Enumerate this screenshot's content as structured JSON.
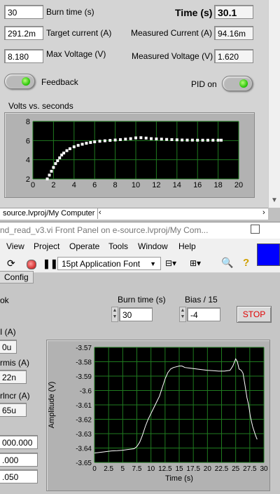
{
  "front_panel_top": {
    "burn_time": {
      "label": "Burn time (s)",
      "value": "30"
    },
    "target_current": {
      "label": "Target current (A)",
      "value": "291.2m"
    },
    "max_voltage": {
      "label": "Max Voltage (V)",
      "value": "8.180"
    },
    "time": {
      "label": "Time (s)",
      "value": "30.1"
    },
    "measured_current": {
      "label": "Measured Current (A)",
      "value": "94.16m"
    },
    "measured_voltage": {
      "label": "Measured Voltage (V)",
      "value": "1.620"
    },
    "feedback": {
      "label": "Feedback",
      "state": "on"
    },
    "pid": {
      "label": "PID on",
      "state": "on"
    },
    "graph_title": "Volts vs. seconds",
    "led_color": "#1fbf00"
  },
  "project_tab": {
    "label": "source.lvproj/My Computer"
  },
  "window2": {
    "title": "nd_read_v3.vi Front Panel on e-source.lvproj/My Com...",
    "menus": [
      "View",
      "Project",
      "Operate",
      "Tools",
      "Window",
      "Help"
    ],
    "font_select": "15pt Application Font",
    "config_tab": "Config",
    "burn_time": {
      "label": "Burn time (s)",
      "value": "30"
    },
    "bias": {
      "label": "Bias / 15",
      "value": "-4"
    },
    "stop_label": "STOP",
    "left_labels": {
      "ok": "ok",
      "current": "I (A)",
      "current_value": "0u",
      "rms": "rmis (A)",
      "rms_value": "22n",
      "incr": "rlncr (A)",
      "incr_value": "65u"
    },
    "left_values": [
      "000.000",
      ".000",
      ".050"
    ],
    "indicator_color": "#0000ff"
  },
  "chart_data": [
    {
      "type": "scatter",
      "title": "Volts vs. seconds",
      "xlabel": "",
      "ylabel": "",
      "xlim": [
        0,
        20
      ],
      "ylim": [
        2,
        8
      ],
      "xticks": [
        "0",
        "2",
        "4",
        "6",
        "8",
        "10",
        "12",
        "14",
        "16",
        "18",
        "20"
      ],
      "yticks": [
        "2",
        "4",
        "6",
        "8"
      ],
      "grid": true,
      "series": [
        {
          "x": [
            1.4,
            1.6,
            1.8,
            2.0,
            2.2,
            2.4,
            2.6,
            2.8,
            3.0,
            3.3,
            3.6,
            4.0,
            4.4,
            4.8,
            5.2,
            5.6,
            6.0,
            6.5,
            7.0,
            7.5,
            8.0,
            8.5,
            9.0,
            9.5,
            10.0,
            10.5,
            11.0,
            11.5,
            12.0,
            12.5,
            13.0,
            13.5,
            14.0,
            14.5,
            15.0,
            15.5,
            16.0,
            16.5,
            17.0,
            17.5,
            18.0,
            18.3
          ],
          "y": [
            2.0,
            2.4,
            2.8,
            3.2,
            3.6,
            3.9,
            4.2,
            4.5,
            4.7,
            4.95,
            5.15,
            5.35,
            5.5,
            5.62,
            5.72,
            5.8,
            5.87,
            5.93,
            5.98,
            6.02,
            6.06,
            6.1,
            6.15,
            6.2,
            6.28,
            6.3,
            6.26,
            6.2,
            6.17,
            6.15,
            6.12,
            6.1,
            6.08,
            6.06,
            6.05,
            6.05,
            6.04,
            6.04,
            6.04,
            6.04,
            6.04,
            6.04
          ]
        }
      ]
    },
    {
      "type": "line",
      "title": "",
      "xlabel": "Time (s)",
      "ylabel": "Amplitude (V)",
      "xlim": [
        0,
        30
      ],
      "ylim": [
        -3.65,
        -3.57
      ],
      "xticks": [
        "0",
        "2.5",
        "5",
        "7.5",
        "10",
        "12.5",
        "15",
        "17.5",
        "20",
        "22.5",
        "25",
        "27.5",
        "30"
      ],
      "yticks": [
        "-3.57",
        "-3.58",
        "-3.59",
        "-3.6",
        "-3.61",
        "-3.62",
        "-3.63",
        "-3.64",
        "-3.65"
      ],
      "grid": true,
      "series": [
        {
          "x": [
            0,
            1,
            2,
            3,
            4,
            5,
            6,
            7,
            7.5,
            8,
            8.5,
            9,
            9.5,
            10,
            10.5,
            11,
            11.5,
            12,
            12.5,
            13,
            13.5,
            14,
            14.5,
            15,
            15.5,
            16,
            17,
            18,
            19,
            20,
            21,
            22,
            23,
            24,
            24.5,
            25,
            25.3,
            25.6,
            26,
            26.3,
            26.6,
            27,
            27.3,
            27.6,
            28,
            28.5,
            28.8
          ],
          "y": [
            -3.6435,
            -3.643,
            -3.6425,
            -3.642,
            -3.6418,
            -3.6415,
            -3.641,
            -3.6405,
            -3.639,
            -3.636,
            -3.631,
            -3.625,
            -3.62,
            -3.616,
            -3.612,
            -3.608,
            -3.604,
            -3.598,
            -3.592,
            -3.5875,
            -3.585,
            -3.584,
            -3.5835,
            -3.583,
            -3.583,
            -3.584,
            -3.5845,
            -3.585,
            -3.5855,
            -3.586,
            -3.5862,
            -3.5865,
            -3.5865,
            -3.586,
            -3.583,
            -3.578,
            -3.58,
            -3.585,
            -3.586,
            -3.588,
            -3.595,
            -3.605,
            -3.61,
            -3.618,
            -3.625,
            -3.631,
            -3.634
          ]
        }
      ]
    }
  ]
}
